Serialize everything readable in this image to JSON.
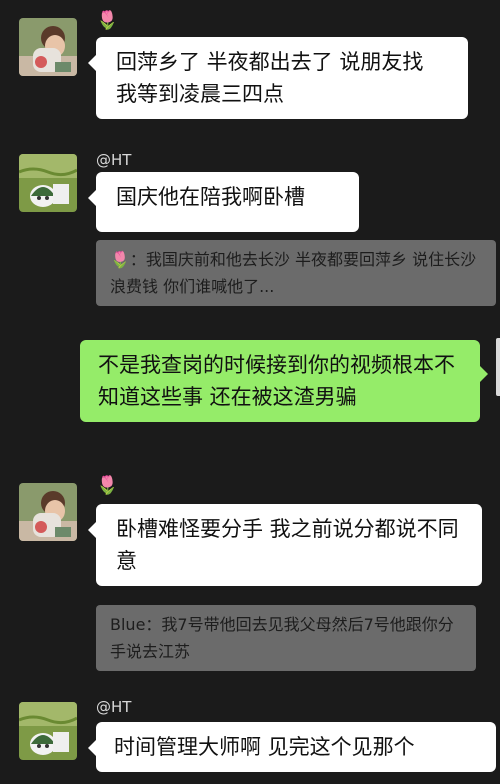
{
  "messages": [
    {
      "flower": "🌷",
      "text": "回萍乡了  半夜都出去了  说朋友找  我等到凌晨三四点"
    },
    {
      "name": "@HT",
      "text": "国庆他在陪我啊卧槽",
      "quote": "🌷：我国庆前和他去长沙  半夜都要回萍乡  说住长沙浪费钱  你们谁喊他了..."
    },
    {
      "text": "不是我查岗的时候接到你的视频根本不知道这些事 还在被这渣男骗"
    },
    {
      "flower": "🌷",
      "text": "卧槽难怪要分手  我之前说分都说不同意",
      "quote": "Blue：我7号带他回去见我父母然后7号他跟你分手说去江苏"
    },
    {
      "name": "@HT",
      "text": "时间管理大师啊 见完这个见那个"
    }
  ],
  "icons": {
    "avatar_a": "child-photo-avatar",
    "avatar_b": "field-photo-avatar"
  },
  "colors": {
    "background": "#1b1b1b",
    "incoming_bubble": "#ffffff",
    "outgoing_bubble": "#95ec69",
    "quote_bubble": "#6b6b6b"
  }
}
